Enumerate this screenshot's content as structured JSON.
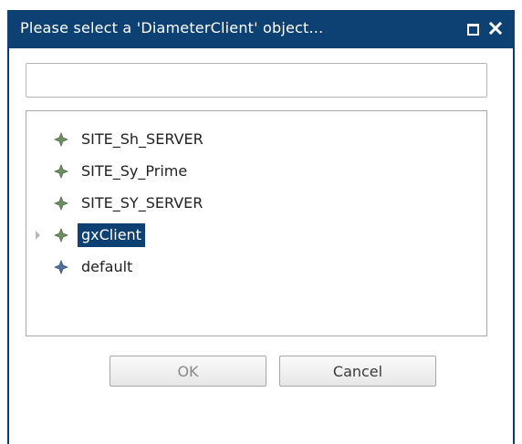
{
  "dialog": {
    "title": "Please select a 'DiameterClient' object...",
    "controls": {
      "maximize_icon": "maximize-icon",
      "close_icon": "close-icon"
    }
  },
  "filter": {
    "value": "",
    "placeholder": ""
  },
  "tree": {
    "items": [
      {
        "label": "SITE_Sh_SERVER",
        "icon": "diamond-node-icon",
        "icon_color": "#6f8f63",
        "expandable": false,
        "selected": false
      },
      {
        "label": "SITE_Sy_Prime",
        "icon": "diamond-node-icon",
        "icon_color": "#6f8f63",
        "expandable": false,
        "selected": false
      },
      {
        "label": "SITE_SY_SERVER",
        "icon": "diamond-node-icon",
        "icon_color": "#6f8f63",
        "expandable": false,
        "selected": false
      },
      {
        "label": "gxClient",
        "icon": "diamond-node-icon",
        "icon_color": "#6f8f63",
        "expandable": true,
        "selected": true
      },
      {
        "label": "default",
        "icon": "diamond-node-icon",
        "icon_color": "#4f6f9f",
        "expandable": false,
        "selected": false
      }
    ]
  },
  "buttons": {
    "ok_label": "OK",
    "cancel_label": "Cancel"
  },
  "colors": {
    "titlebar": "#0e4173",
    "selection": "#0e4173"
  }
}
